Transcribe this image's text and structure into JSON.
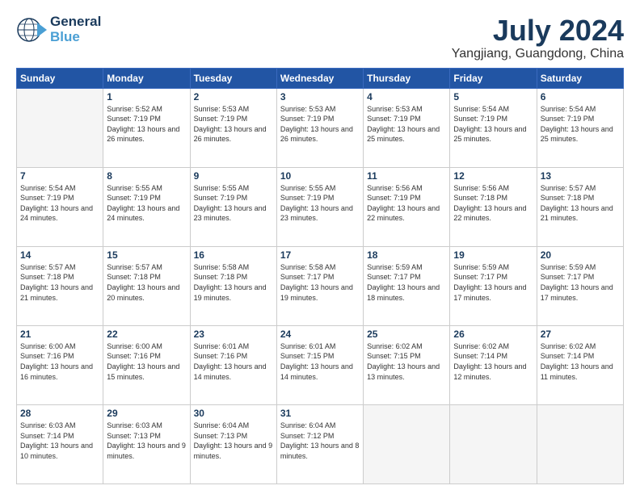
{
  "header": {
    "logo_line1": "General",
    "logo_line2": "Blue",
    "month_year": "July 2024",
    "location": "Yangjiang, Guangdong, China"
  },
  "weekdays": [
    "Sunday",
    "Monday",
    "Tuesday",
    "Wednesday",
    "Thursday",
    "Friday",
    "Saturday"
  ],
  "weeks": [
    [
      {
        "day": "",
        "empty": true
      },
      {
        "day": "1",
        "sunrise": "5:52 AM",
        "sunset": "7:19 PM",
        "daylight": "13 hours and 26 minutes."
      },
      {
        "day": "2",
        "sunrise": "5:53 AM",
        "sunset": "7:19 PM",
        "daylight": "13 hours and 26 minutes."
      },
      {
        "day": "3",
        "sunrise": "5:53 AM",
        "sunset": "7:19 PM",
        "daylight": "13 hours and 26 minutes."
      },
      {
        "day": "4",
        "sunrise": "5:53 AM",
        "sunset": "7:19 PM",
        "daylight": "13 hours and 25 minutes."
      },
      {
        "day": "5",
        "sunrise": "5:54 AM",
        "sunset": "7:19 PM",
        "daylight": "13 hours and 25 minutes."
      },
      {
        "day": "6",
        "sunrise": "5:54 AM",
        "sunset": "7:19 PM",
        "daylight": "13 hours and 25 minutes."
      }
    ],
    [
      {
        "day": "7",
        "sunrise": "5:54 AM",
        "sunset": "7:19 PM",
        "daylight": "13 hours and 24 minutes."
      },
      {
        "day": "8",
        "sunrise": "5:55 AM",
        "sunset": "7:19 PM",
        "daylight": "13 hours and 24 minutes."
      },
      {
        "day": "9",
        "sunrise": "5:55 AM",
        "sunset": "7:19 PM",
        "daylight": "13 hours and 23 minutes."
      },
      {
        "day": "10",
        "sunrise": "5:55 AM",
        "sunset": "7:19 PM",
        "daylight": "13 hours and 23 minutes."
      },
      {
        "day": "11",
        "sunrise": "5:56 AM",
        "sunset": "7:19 PM",
        "daylight": "13 hours and 22 minutes."
      },
      {
        "day": "12",
        "sunrise": "5:56 AM",
        "sunset": "7:18 PM",
        "daylight": "13 hours and 22 minutes."
      },
      {
        "day": "13",
        "sunrise": "5:57 AM",
        "sunset": "7:18 PM",
        "daylight": "13 hours and 21 minutes."
      }
    ],
    [
      {
        "day": "14",
        "sunrise": "5:57 AM",
        "sunset": "7:18 PM",
        "daylight": "13 hours and 21 minutes."
      },
      {
        "day": "15",
        "sunrise": "5:57 AM",
        "sunset": "7:18 PM",
        "daylight": "13 hours and 20 minutes."
      },
      {
        "day": "16",
        "sunrise": "5:58 AM",
        "sunset": "7:18 PM",
        "daylight": "13 hours and 19 minutes."
      },
      {
        "day": "17",
        "sunrise": "5:58 AM",
        "sunset": "7:17 PM",
        "daylight": "13 hours and 19 minutes."
      },
      {
        "day": "18",
        "sunrise": "5:59 AM",
        "sunset": "7:17 PM",
        "daylight": "13 hours and 18 minutes."
      },
      {
        "day": "19",
        "sunrise": "5:59 AM",
        "sunset": "7:17 PM",
        "daylight": "13 hours and 17 minutes."
      },
      {
        "day": "20",
        "sunrise": "5:59 AM",
        "sunset": "7:17 PM",
        "daylight": "13 hours and 17 minutes."
      }
    ],
    [
      {
        "day": "21",
        "sunrise": "6:00 AM",
        "sunset": "7:16 PM",
        "daylight": "13 hours and 16 minutes."
      },
      {
        "day": "22",
        "sunrise": "6:00 AM",
        "sunset": "7:16 PM",
        "daylight": "13 hours and 15 minutes."
      },
      {
        "day": "23",
        "sunrise": "6:01 AM",
        "sunset": "7:16 PM",
        "daylight": "13 hours and 14 minutes."
      },
      {
        "day": "24",
        "sunrise": "6:01 AM",
        "sunset": "7:15 PM",
        "daylight": "13 hours and 14 minutes."
      },
      {
        "day": "25",
        "sunrise": "6:02 AM",
        "sunset": "7:15 PM",
        "daylight": "13 hours and 13 minutes."
      },
      {
        "day": "26",
        "sunrise": "6:02 AM",
        "sunset": "7:14 PM",
        "daylight": "13 hours and 12 minutes."
      },
      {
        "day": "27",
        "sunrise": "6:02 AM",
        "sunset": "7:14 PM",
        "daylight": "13 hours and 11 minutes."
      }
    ],
    [
      {
        "day": "28",
        "sunrise": "6:03 AM",
        "sunset": "7:14 PM",
        "daylight": "13 hours and 10 minutes."
      },
      {
        "day": "29",
        "sunrise": "6:03 AM",
        "sunset": "7:13 PM",
        "daylight": "13 hours and 9 minutes."
      },
      {
        "day": "30",
        "sunrise": "6:04 AM",
        "sunset": "7:13 PM",
        "daylight": "13 hours and 9 minutes."
      },
      {
        "day": "31",
        "sunrise": "6:04 AM",
        "sunset": "7:12 PM",
        "daylight": "13 hours and 8 minutes."
      },
      {
        "day": "",
        "empty": true
      },
      {
        "day": "",
        "empty": true
      },
      {
        "day": "",
        "empty": true
      }
    ]
  ]
}
